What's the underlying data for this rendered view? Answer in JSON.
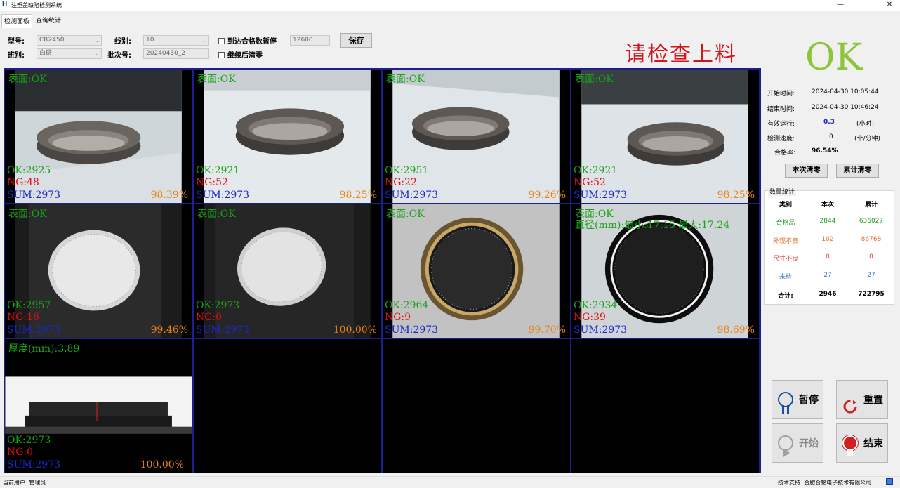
{
  "window": {
    "logo": "H",
    "title": "注塑盖缺陷检测系统",
    "min": "—",
    "max": "❐",
    "close": "✕"
  },
  "tabs": [
    {
      "label": "检测面板"
    },
    {
      "label": "查询统计"
    }
  ],
  "toolbar": {
    "model_label": "型号:",
    "model_value": "CR2450",
    "shift_label": "班别:",
    "shift_value": "白班",
    "line_label": "线别:",
    "line_value": "10",
    "batch_label": "批次号:",
    "batch_value": "20240430_2",
    "stop_label": "到达合格数暂停",
    "stop_value": "12600",
    "clear_label": "继续后清零",
    "save_label": "保存"
  },
  "status_message": "请检查上料",
  "cells": [
    {
      "head": "表面:OK",
      "ok": "OK:2925",
      "ng": "NG:48",
      "sum": "SUM:2973",
      "rate": "98.39%"
    },
    {
      "head": "表面:OK",
      "ok": "OK:2921",
      "ng": "NG:52",
      "sum": "SUM:2973",
      "rate": "98.25%"
    },
    {
      "head": "表面:OK",
      "ok": "OK:2951",
      "ng": "NG:22",
      "sum": "SUM:2973",
      "rate": "99.26%"
    },
    {
      "head": "表面:OK",
      "ok": "OK:2921",
      "ng": "NG:52",
      "sum": "SUM:2973",
      "rate": "98.25%"
    },
    {
      "head": "表面:OK",
      "ok": "OK:2957",
      "ng": "NG:16",
      "sum": "SUM:2973",
      "rate": "99.46%"
    },
    {
      "head": "表面:OK",
      "ok": "OK:2973",
      "ng": "NG:0",
      "sum": "SUM:2973",
      "rate": "100.00%"
    },
    {
      "head": "表面:OK",
      "ok": "OK:2964",
      "ng": "NG:9",
      "sum": "SUM:2973",
      "rate": "99.70%"
    },
    {
      "head": "表面:OK",
      "head2": "直径(mm):最小:17.15 最大:17.24",
      "ok": "OK:2934",
      "ng": "NG:39",
      "sum": "SUM:2973",
      "rate": "98.69%"
    },
    {
      "head": "厚度(mm):3.89",
      "ok": "OK:2973",
      "ng": "NG:0",
      "sum": "SUM:2973",
      "rate": "100.00%"
    }
  ],
  "result": {
    "text": "OK"
  },
  "info": {
    "start_label": "开始时间:",
    "start_value": "2024-04-30 10:05:44",
    "end_label": "结束时间:",
    "end_value": "2024-04-30 10:46:24",
    "run_label": "有效运行:",
    "run_value": "0.3",
    "run_unit": "(小时)",
    "speed_label": "检测速度:",
    "speed_value": "0",
    "speed_unit": "(个/分钟)",
    "pass_label": "合格率:",
    "pass_value": "96.54%"
  },
  "buttons": {
    "clear_current": "本次清零",
    "clear_total": "累计清零",
    "pause": "暂停",
    "reset": "重置",
    "start": "开始",
    "end": "结束"
  },
  "stats": {
    "title": "数量统计",
    "headers": [
      "类别",
      "本次",
      "累计"
    ],
    "rows": [
      {
        "name": "合格品",
        "cur": "2844",
        "total": "636027",
        "color": "#1f9e1f"
      },
      {
        "name": "外观不良",
        "cur": "102",
        "total": "86768",
        "color": "#e07030"
      },
      {
        "name": "尺寸不良",
        "cur": "0",
        "total": "0",
        "color": "#e04040"
      },
      {
        "name": "未检",
        "cur": "27",
        "total": "27",
        "color": "#3a7bd5"
      },
      {
        "name": "合计:",
        "cur": "2946",
        "total": "722795",
        "color": "#000000"
      }
    ]
  },
  "statusbar": {
    "user": "当前用户: 管理员",
    "support": "技术支持: 合肥合铭电子技术有限公司"
  }
}
